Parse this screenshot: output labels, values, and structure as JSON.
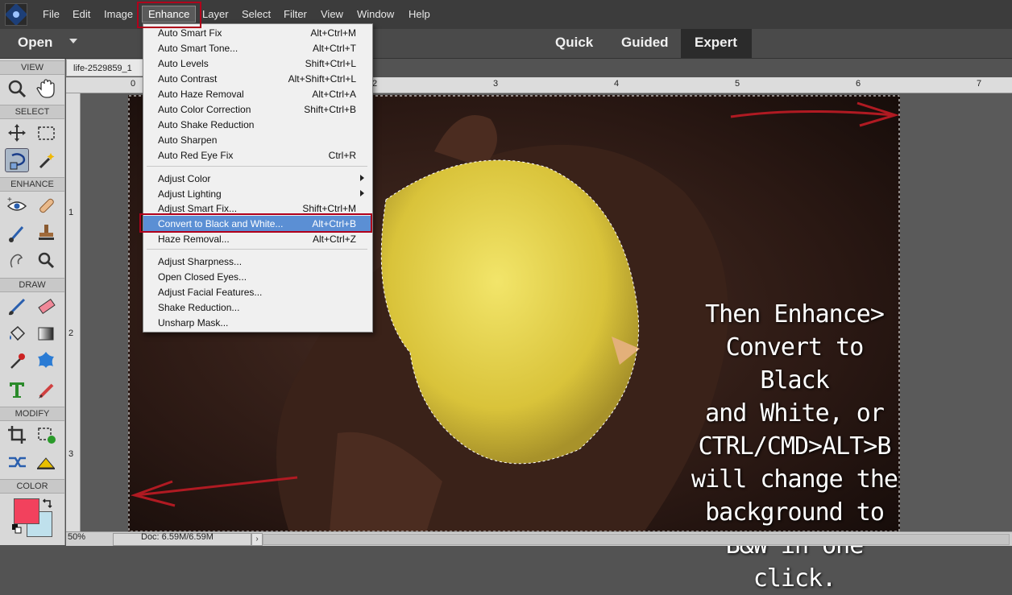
{
  "menubar": {
    "items": [
      "File",
      "Edit",
      "Image",
      "Enhance",
      "Layer",
      "Select",
      "Filter",
      "View",
      "Window",
      "Help"
    ]
  },
  "modebar": {
    "open_label": "Open",
    "modes": [
      "Quick",
      "Guided",
      "Expert"
    ]
  },
  "toolbox": {
    "sections": [
      "VIEW",
      "SELECT",
      "ENHANCE",
      "DRAW",
      "MODIFY",
      "COLOR"
    ]
  },
  "document": {
    "tab_name": "life-2529859_1",
    "zoom": "50%",
    "doc_size": "Doc: 6.59M/6.59M"
  },
  "rulers": {
    "h": [
      "0",
      "1",
      "2",
      "3",
      "4",
      "5",
      "6",
      "7"
    ],
    "v": [
      "1",
      "2",
      "3"
    ]
  },
  "enhance_menu": {
    "items": [
      {
        "label": "Auto Smart Fix",
        "shortcut": "Alt+Ctrl+M"
      },
      {
        "label": "Auto Smart Tone...",
        "shortcut": "Alt+Ctrl+T"
      },
      {
        "label": "Auto Levels",
        "shortcut": "Shift+Ctrl+L"
      },
      {
        "label": "Auto Contrast",
        "shortcut": "Alt+Shift+Ctrl+L"
      },
      {
        "label": "Auto Haze Removal",
        "shortcut": "Alt+Ctrl+A"
      },
      {
        "label": "Auto Color Correction",
        "shortcut": "Shift+Ctrl+B"
      },
      {
        "label": "Auto Shake Reduction",
        "shortcut": ""
      },
      {
        "label": "Auto Sharpen",
        "shortcut": ""
      },
      {
        "label": "Auto Red Eye Fix",
        "shortcut": "Ctrl+R"
      },
      {
        "label": "Adjust Color",
        "shortcut": ""
      },
      {
        "label": "Adjust Lighting",
        "shortcut": ""
      },
      {
        "label": "Adjust Smart Fix...",
        "shortcut": "Shift+Ctrl+M"
      },
      {
        "label": "Convert to Black and White...",
        "shortcut": "Alt+Ctrl+B"
      },
      {
        "label": "Haze Removal...",
        "shortcut": "Alt+Ctrl+Z"
      },
      {
        "label": "Adjust Sharpness...",
        "shortcut": ""
      },
      {
        "label": "Open Closed Eyes...",
        "shortcut": ""
      },
      {
        "label": "Adjust Facial Features...",
        "shortcut": ""
      },
      {
        "label": "Shake Reduction...",
        "shortcut": ""
      },
      {
        "label": "Unsharp Mask...",
        "shortcut": ""
      }
    ]
  },
  "annotation": {
    "lines": [
      "Then Enhance>",
      "Convert to Black",
      "and White, or",
      "CTRL/CMD>ALT>B",
      "will change the",
      "background to",
      "B&W in one click."
    ]
  },
  "colors": {
    "foreground": "#f2415d",
    "background": "#bfe0ec",
    "highlight": "#b0001b",
    "menu_selection": "#5b8fd4"
  }
}
